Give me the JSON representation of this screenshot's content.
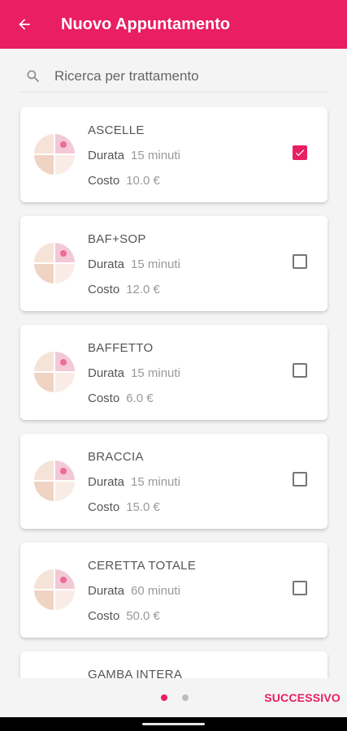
{
  "header": {
    "title": "Nuovo Appuntamento",
    "back_icon": "arrow-left-icon"
  },
  "search": {
    "placeholder": "Ricerca per trattamento",
    "icon": "search-icon"
  },
  "colors": {
    "accent": "#e91e63"
  },
  "labels": {
    "duration": "Durata",
    "cost": "Costo"
  },
  "treatments": [
    {
      "name": "ASCELLE",
      "duration": "15 minuti",
      "cost": "10.0 €",
      "selected": true
    },
    {
      "name": "BAF+SOP",
      "duration": "15 minuti",
      "cost": "12.0 €",
      "selected": false
    },
    {
      "name": "BAFFETTO",
      "duration": "15 minuti",
      "cost": "6.0 €",
      "selected": false
    },
    {
      "name": "BRACCIA",
      "duration": "15 minuti",
      "cost": "15.0 €",
      "selected": false
    },
    {
      "name": "CERETTA TOTALE",
      "duration": "60 minuti",
      "cost": "50.0 €",
      "selected": false
    },
    {
      "name": "GAMBA INTERA",
      "duration": "",
      "cost": "",
      "selected": false
    }
  ],
  "footer": {
    "next_label": "SUCCESSIVO",
    "page_count": 2,
    "current_page": 1
  }
}
